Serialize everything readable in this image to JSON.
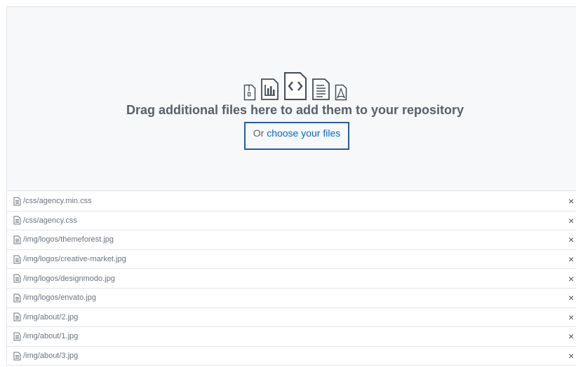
{
  "dropzone": {
    "title": "Drag additional files here to add them to your repository",
    "choose_prefix": "Or ",
    "choose_link": "choose your files",
    "icons": [
      "zip-file-icon",
      "chart-file-icon",
      "code-file-icon",
      "text-file-icon",
      "pdf-file-icon"
    ]
  },
  "files": [
    {
      "name": "/css/agency.min.css",
      "remove": "×"
    },
    {
      "name": "/css/agency.css",
      "remove": "×"
    },
    {
      "name": "/img/logos/themeforest.jpg",
      "remove": "×"
    },
    {
      "name": "/img/logos/creative-market.jpg",
      "remove": "×"
    },
    {
      "name": "/img/logos/designmodo.jpg",
      "remove": "×"
    },
    {
      "name": "/img/logos/envato.jpg",
      "remove": "×"
    },
    {
      "name": "/img/about/2.jpg",
      "remove": "×"
    },
    {
      "name": "/img/about/1.jpg",
      "remove": "×"
    },
    {
      "name": "/img/about/3.jpg",
      "remove": "×"
    }
  ],
  "colors": {
    "link": "#0366d6",
    "focus_outline": "#2a5a9e",
    "dropzone_bg": "#f6f8fa"
  }
}
